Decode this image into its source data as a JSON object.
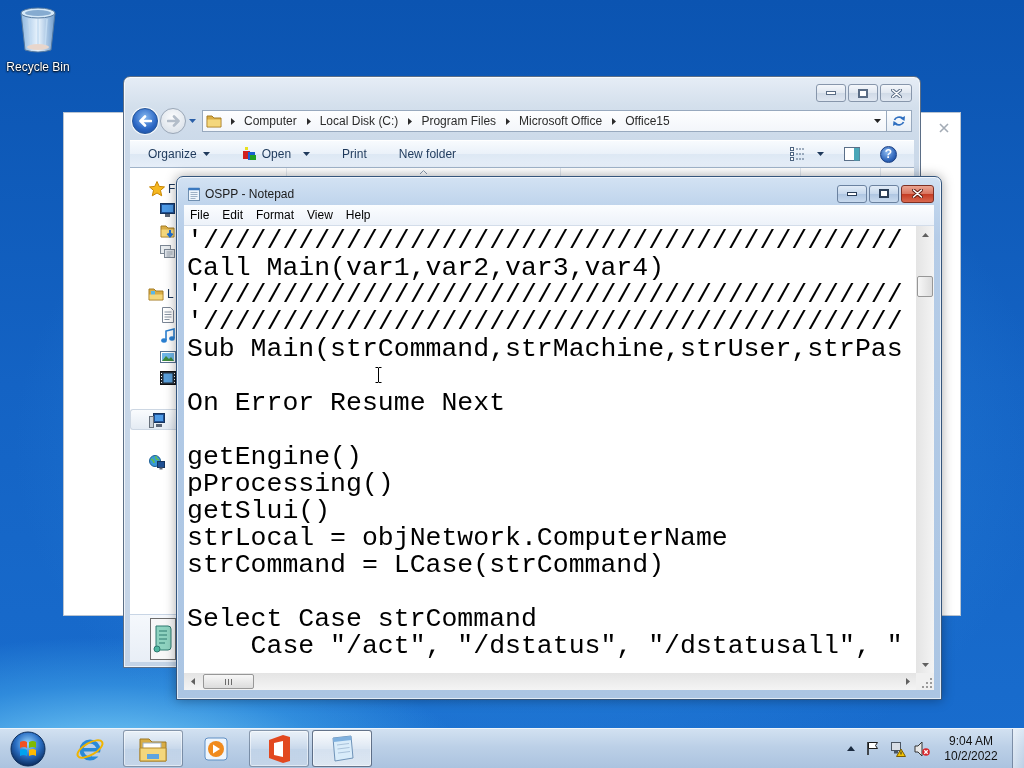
{
  "desktop": {
    "icons": [
      {
        "label": "Recycle Bin"
      }
    ]
  },
  "explorer": {
    "address": [
      "Computer",
      "Local Disk (C:)",
      "Program Files",
      "Microsoft Office",
      "Office15"
    ],
    "toolbar": [
      {
        "label": "Organize",
        "kind": "menu"
      },
      {
        "label": "Open",
        "kind": "app_menu"
      },
      {
        "label": "Print",
        "kind": "button"
      },
      {
        "label": "New folder",
        "kind": "button"
      }
    ],
    "help": "?",
    "nav": [
      {
        "kind": "favorites",
        "label": "F",
        "selected": false
      },
      {
        "kind": "desktop",
        "selected": false
      },
      {
        "kind": "downloads",
        "selected": false
      },
      {
        "kind": "recent",
        "selected": false
      },
      {
        "kind": "libraries",
        "label": "L",
        "selected": false
      },
      {
        "kind": "documents",
        "selected": false
      },
      {
        "kind": "music",
        "selected": false
      },
      {
        "kind": "pictures",
        "selected": false
      },
      {
        "kind": "videos",
        "selected": false
      },
      {
        "kind": "computer",
        "selected": true
      },
      {
        "kind": "network",
        "selected": false
      }
    ]
  },
  "notepad": {
    "title": "OSPP - Notepad",
    "menu": [
      "File",
      "Edit",
      "Format",
      "View",
      "Help"
    ],
    "blocks": [
      "'////////////////////////////////////////////\nCall Main(var1,var2,var3,var4)\n'////////////////////////////////////////////\n'////////////////////////////////////////////\nSub Main(strCommand,strMachine,strUser,strPas",
      "On Error Resume Next",
      "getEngine()\npProcessing()\ngetSlui()\nstrLocal = objNetwork.ComputerName\nstrCommand = LCase(strCommand)",
      "Select Case strCommand\n    Case \"/act\", \"/dstatus\", \"/dstatusall\", \""
    ]
  },
  "taskbar": {
    "apps": [
      {
        "kind": "browser",
        "running": false,
        "active": false
      },
      {
        "kind": "explorer",
        "running": true,
        "active": false
      },
      {
        "kind": "media",
        "running": false,
        "active": false
      },
      {
        "kind": "office",
        "running": true,
        "active": false
      },
      {
        "kind": "notepad",
        "running": true,
        "active": true
      }
    ],
    "clock": {
      "time": "9:04 AM",
      "date": "10/2/2022"
    }
  }
}
